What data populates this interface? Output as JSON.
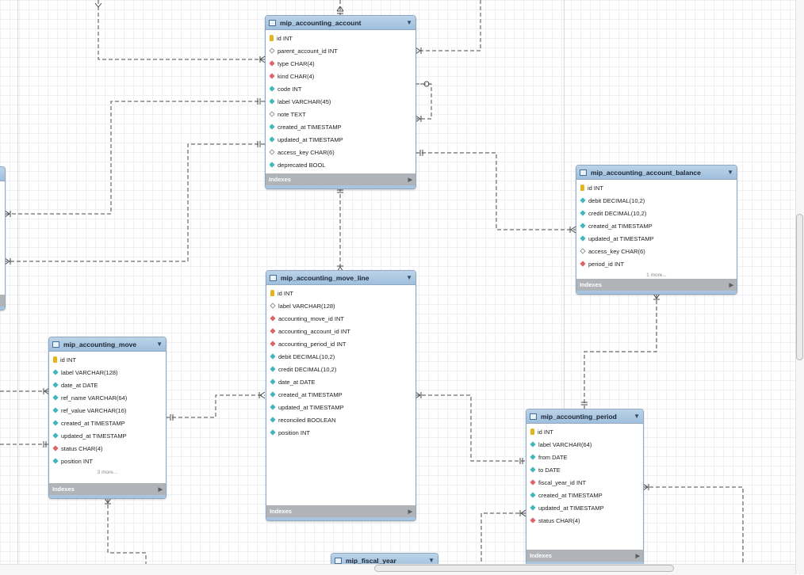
{
  "colors": {
    "header": "#a9c6e1",
    "indexes_bar": "#b0b3b8",
    "relationship_line": "#4a4a4a",
    "pk_icon": "#e3b51c",
    "column_icon": "#45b5bd",
    "fk_icon": "#d9676a"
  },
  "icons": {
    "table": "table-icon",
    "collapse": "collapse-triangle-icon",
    "primary_key": "key-icon",
    "column": "column-diamond-icon",
    "foreign_key": "foreign-key-diamond-icon",
    "nullable": "nullable-diamond-icon",
    "expand_indexes": "expand-arrow-icon"
  },
  "indexes_label": "Indexes",
  "tables": [
    {
      "name": "mip_accounting_account",
      "columns": [
        {
          "text": "id INT",
          "kind": "pk"
        },
        {
          "text": "parent_account_id INT",
          "kind": "nn"
        },
        {
          "text": "type CHAR(4)",
          "kind": "fk"
        },
        {
          "text": "kind CHAR(4)",
          "kind": "fk"
        },
        {
          "text": "code INT",
          "kind": "col"
        },
        {
          "text": "label VARCHAR(45)",
          "kind": "col"
        },
        {
          "text": "note TEXT",
          "kind": "nn"
        },
        {
          "text": "created_at TIMESTAMP",
          "kind": "col"
        },
        {
          "text": "updated_at TIMESTAMP",
          "kind": "col"
        },
        {
          "text": "access_key CHAR(6)",
          "kind": "nn"
        },
        {
          "text": "deprecated BOOL",
          "kind": "col"
        }
      ],
      "more": ""
    },
    {
      "name": "mip_accounting_account_balance",
      "columns": [
        {
          "text": "id INT",
          "kind": "pk"
        },
        {
          "text": "debit DECIMAL(10,2)",
          "kind": "col"
        },
        {
          "text": "credit DECIMAL(10,2)",
          "kind": "col"
        },
        {
          "text": "created_at TIMESTAMP",
          "kind": "col"
        },
        {
          "text": "updated_at TIMESTAMP",
          "kind": "col"
        },
        {
          "text": "access_key CHAR(6)",
          "kind": "nn"
        },
        {
          "text": "period_id INT",
          "kind": "fk"
        }
      ],
      "more": "1 more..."
    },
    {
      "name": "mip_accounting_move_line",
      "columns": [
        {
          "text": "id INT",
          "kind": "pk"
        },
        {
          "text": "label VARCHAR(128)",
          "kind": "nn"
        },
        {
          "text": "accounting_move_id INT",
          "kind": "fk"
        },
        {
          "text": "accounting_account_id INT",
          "kind": "fk"
        },
        {
          "text": "accounting_period_id INT",
          "kind": "fk"
        },
        {
          "text": "debit DECIMAL(10,2)",
          "kind": "col"
        },
        {
          "text": "credit DECIMAL(10,2)",
          "kind": "col"
        },
        {
          "text": "date_at DATE",
          "kind": "col"
        },
        {
          "text": "created_at TIMESTAMP",
          "kind": "col"
        },
        {
          "text": "updated_at TIMESTAMP",
          "kind": "col"
        },
        {
          "text": "reconciled BOOLEAN",
          "kind": "col"
        },
        {
          "text": "position INT",
          "kind": "col"
        }
      ],
      "more": ""
    },
    {
      "name": "mip_accounting_move",
      "columns": [
        {
          "text": "id INT",
          "kind": "pk"
        },
        {
          "text": "label VARCHAR(128)",
          "kind": "col"
        },
        {
          "text": "date_at DATE",
          "kind": "col"
        },
        {
          "text": "ref_name VARCHAR(64)",
          "kind": "col"
        },
        {
          "text": "ref_value VARCHAR(16)",
          "kind": "col"
        },
        {
          "text": "created_at TIMESTAMP",
          "kind": "col"
        },
        {
          "text": "updated_at TIMESTAMP",
          "kind": "col"
        },
        {
          "text": "status CHAR(4)",
          "kind": "fk"
        },
        {
          "text": "position INT",
          "kind": "col"
        }
      ],
      "more": "3 more..."
    },
    {
      "name": "mip_accounting_period",
      "columns": [
        {
          "text": "id INT",
          "kind": "pk"
        },
        {
          "text": "label VARCHAR(64)",
          "kind": "col"
        },
        {
          "text": "from DATE",
          "kind": "col"
        },
        {
          "text": "to DATE",
          "kind": "col"
        },
        {
          "text": "fiscal_year_id INT",
          "kind": "fk"
        },
        {
          "text": "created_at TIMESTAMP",
          "kind": "col"
        },
        {
          "text": "updated_at TIMESTAMP",
          "kind": "col"
        },
        {
          "text": "status CHAR(4)",
          "kind": "fk"
        }
      ],
      "more": ""
    },
    {
      "name": "mip_fiscal_year",
      "columns": [],
      "more": ""
    }
  ]
}
